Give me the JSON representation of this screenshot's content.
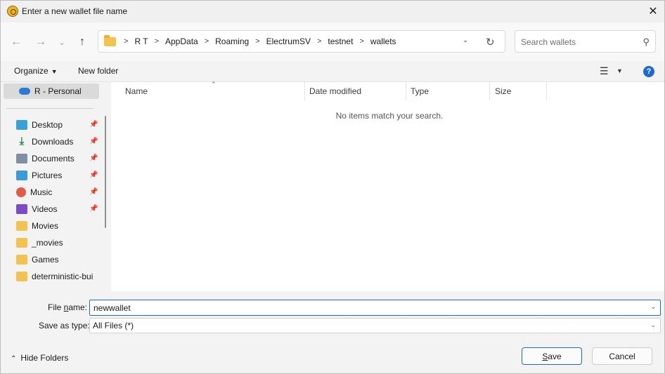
{
  "window": {
    "title": "Enter a new wallet file name"
  },
  "nav": {
    "breadcrumbs": [
      "R T",
      "AppData",
      "Roaming",
      "ElectrumSV",
      "testnet",
      "wallets"
    ],
    "search_placeholder": "Search wallets"
  },
  "toolbar": {
    "organize_label": "Organize",
    "new_folder_label": "New folder",
    "help_label": "?"
  },
  "sidebar": {
    "onedrive_label": "R - Personal",
    "items": [
      {
        "label": "Desktop",
        "icon": "desktop-icon",
        "pinned": true
      },
      {
        "label": "Downloads",
        "icon": "download-icon",
        "pinned": true
      },
      {
        "label": "Documents",
        "icon": "documents-icon",
        "pinned": true
      },
      {
        "label": "Pictures",
        "icon": "pictures-icon",
        "pinned": true
      },
      {
        "label": "Music",
        "icon": "music-icon",
        "pinned": true
      },
      {
        "label": "Videos",
        "icon": "videos-icon",
        "pinned": true
      },
      {
        "label": "Movies",
        "icon": "folder-icon",
        "pinned": false
      },
      {
        "label": "_movies",
        "icon": "folder-icon",
        "pinned": false
      },
      {
        "label": "Games",
        "icon": "folder-icon",
        "pinned": false
      },
      {
        "label": "deterministic-bui",
        "icon": "folder-icon",
        "pinned": false
      }
    ]
  },
  "filelist": {
    "columns": [
      "Name",
      "Date modified",
      "Type",
      "Size"
    ],
    "empty_message": "No items match your search."
  },
  "form": {
    "filename_label_pre": "File ",
    "filename_label_key": "n",
    "filename_label_post": "ame:",
    "filename_value": "newwallet",
    "savetype_label": "Save as type:",
    "savetype_value": "All Files (*)"
  },
  "footer": {
    "hide_folders_label": "Hide Folders",
    "save_label_key": "S",
    "save_label_rest": "ave",
    "cancel_label": "Cancel"
  },
  "colors": {
    "accent": "#1d6ad2",
    "folder": "#f4c24f"
  }
}
